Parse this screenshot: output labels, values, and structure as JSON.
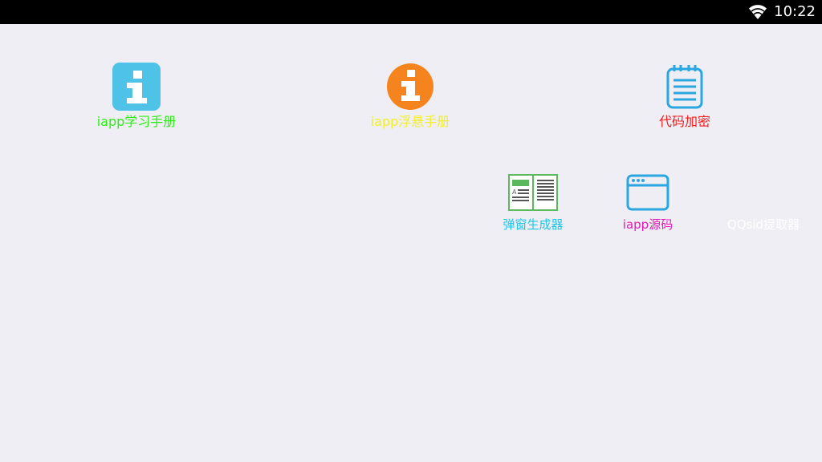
{
  "status_bar": {
    "time": "10:22",
    "icons": [
      "wifi-icon"
    ]
  },
  "apps": [
    {
      "id": "iapp-study-manual",
      "label": "iapp学习手册",
      "icon": "info-square-icon",
      "color": "#27f00f",
      "icon_color": "#4fc2e8"
    },
    {
      "id": "iapp-float-manual",
      "label": "iapp浮悬手册",
      "icon": "info-circle-icon",
      "color": "#f2ef2a",
      "icon_color": "#f5841f"
    },
    {
      "id": "code-encrypt",
      "label": "代码加密",
      "icon": "notepad-icon",
      "color": "#ef1d1d",
      "icon_color": "#2aa6e0"
    },
    {
      "id": "popup-generator",
      "label": "弹窗生成器",
      "icon": "open-book-icon",
      "color": "#1bc6e8",
      "icon_color": "#5cb85c"
    },
    {
      "id": "iapp-source",
      "label": "iapp源码",
      "icon": "browser-window-icon",
      "color": "#e41ab8",
      "icon_color": "#2aa6e0"
    },
    {
      "id": "qqsid-extractor",
      "label": "QQsid提取器",
      "icon": "",
      "color": "#ffffff",
      "icon_color": ""
    }
  ]
}
